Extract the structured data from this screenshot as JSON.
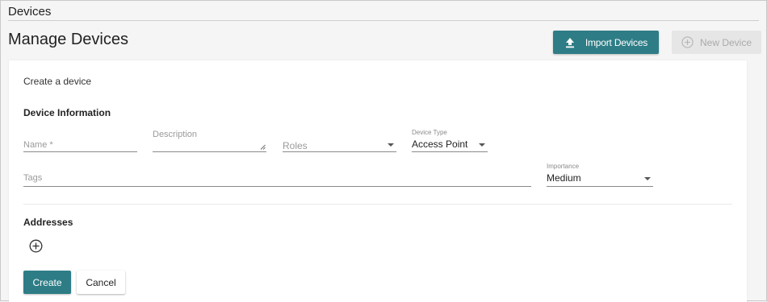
{
  "breadcrumb": {
    "label": "Devices"
  },
  "header": {
    "title": "Manage Devices",
    "import_label": "Import Devices",
    "new_label": "New Device"
  },
  "form": {
    "subtitle": "Create a device",
    "section_device_info": "Device Information",
    "name": {
      "placeholder": "Name *",
      "value": ""
    },
    "description": {
      "placeholder": "Description",
      "value": ""
    },
    "roles": {
      "placeholder": "Roles",
      "value": ""
    },
    "device_type": {
      "label": "Device Type",
      "value": "Access Point"
    },
    "tags": {
      "placeholder": "Tags",
      "value": ""
    },
    "importance": {
      "label": "Importance",
      "value": "Medium"
    },
    "section_addresses": "Addresses",
    "create_label": "Create",
    "cancel_label": "Cancel"
  },
  "colors": {
    "accent": "#2e7d86",
    "disabled_bg": "#e6e6e6",
    "disabled_text": "#aaaaaa"
  },
  "icons": {
    "import": "upload-icon",
    "new": "plus-circle-icon",
    "add_address": "plus-circle-icon"
  }
}
